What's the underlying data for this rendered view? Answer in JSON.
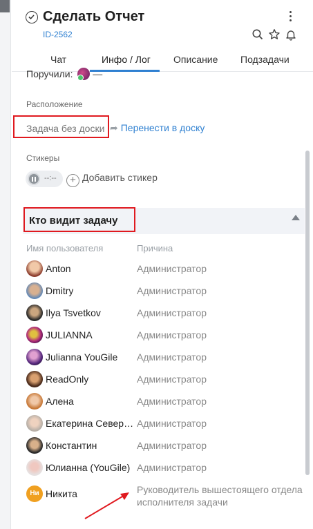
{
  "header": {
    "title": "Сделать Отчет",
    "task_id": "ID-2562"
  },
  "tabs": [
    {
      "label": "Чат"
    },
    {
      "label": "Инфо / Лог",
      "active": true
    },
    {
      "label": "Описание"
    },
    {
      "label": "Подзадачи"
    }
  ],
  "received": {
    "label": "Поручили:",
    "suffix": "—"
  },
  "location": {
    "section_label": "Расположение",
    "value": "Задача без доски",
    "move_link": "Перенести в доску"
  },
  "stickers": {
    "section_label": "Стикеры",
    "timer_text": "--:--",
    "add_label": "Добавить стикер"
  },
  "visibility": {
    "title": "Кто видит задачу",
    "col_user": "Имя пользователя",
    "col_reason": "Причина",
    "rows": [
      {
        "name": "Anton",
        "reason": "Администратор"
      },
      {
        "name": "Dmitry",
        "reason": "Администратор"
      },
      {
        "name": "Ilya Tsvetkov",
        "reason": "Администратор"
      },
      {
        "name": "JULIANNA",
        "reason": "Администратор"
      },
      {
        "name": "Julianna YouGile",
        "reason": "Администратор"
      },
      {
        "name": "ReadOnly",
        "reason": "Администратор"
      },
      {
        "name": "Алена",
        "reason": "Администратор"
      },
      {
        "name": "Екатерина Северова",
        "reason": "Администратор"
      },
      {
        "name": "Константин",
        "reason": "Администратор"
      },
      {
        "name": "Юлианна (YouGile)",
        "reason": "Администратор"
      },
      {
        "name": "Никита",
        "initials": "Ни",
        "reason": "Руководитель вышестоящего отдела исполнителя задачи"
      }
    ]
  },
  "colors": {
    "accent": "#2f80d1",
    "highlight": "#e0191f",
    "initials_avatar": "#f0a020"
  }
}
